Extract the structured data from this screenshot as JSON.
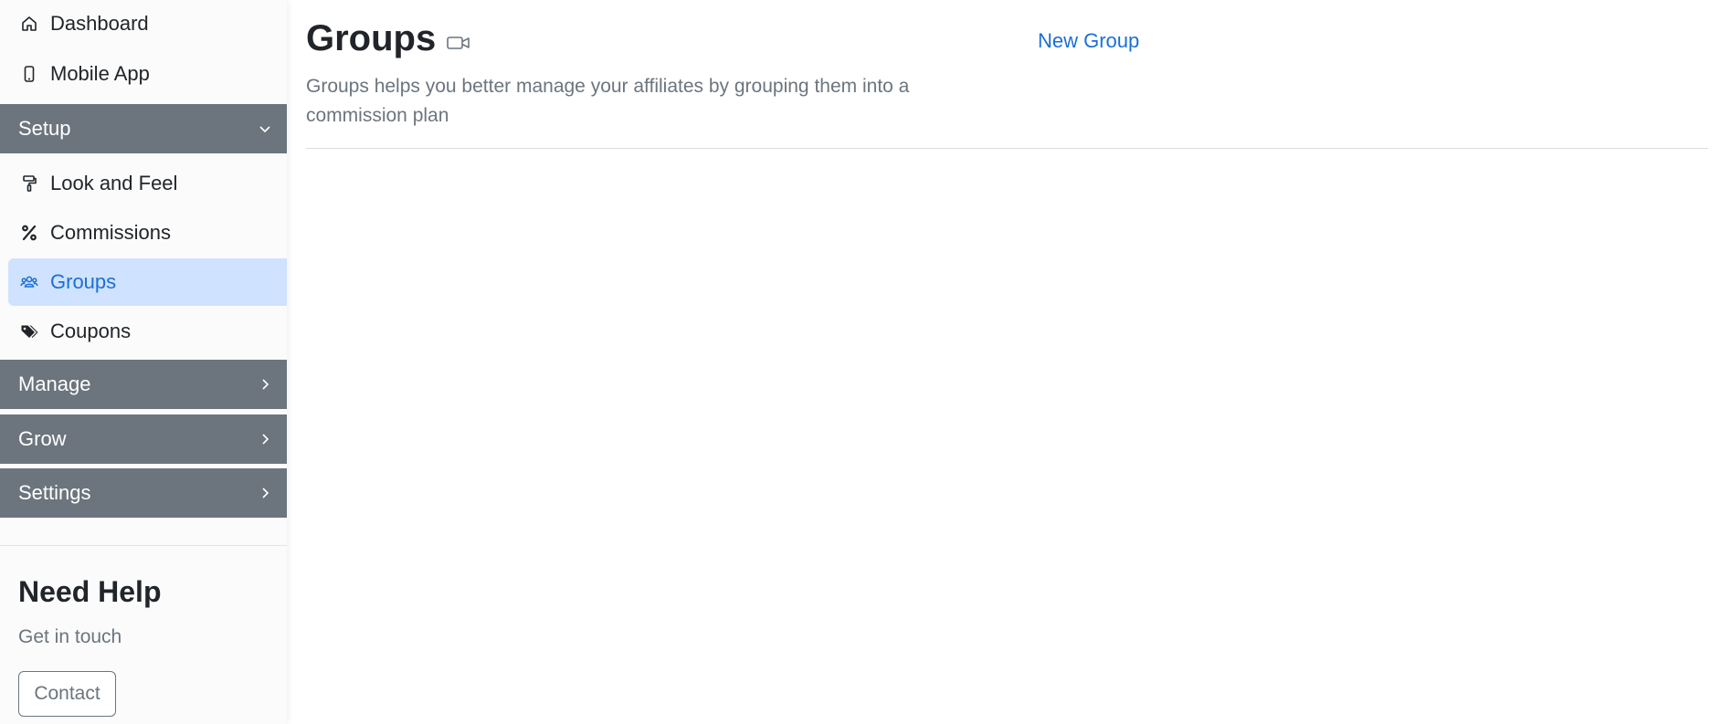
{
  "sidebar": {
    "top_items": [
      {
        "label": "Dashboard",
        "icon": "house-icon"
      },
      {
        "label": "Mobile App",
        "icon": "phone-icon"
      }
    ],
    "sections": {
      "setup": {
        "label": "Setup",
        "expanded": true,
        "items": [
          {
            "label": "Look and Feel",
            "icon": "paint-roller-icon"
          },
          {
            "label": "Commissions",
            "icon": "percent-icon"
          },
          {
            "label": "Groups",
            "icon": "users-icon",
            "active": true
          },
          {
            "label": "Coupons",
            "icon": "tags-icon"
          }
        ]
      },
      "manage": {
        "label": "Manage",
        "expanded": false
      },
      "grow": {
        "label": "Grow",
        "expanded": false
      },
      "settings": {
        "label": "Settings",
        "expanded": false
      }
    },
    "help": {
      "title": "Need Help",
      "subtitle": "Get in touch",
      "contact_label": "Contact"
    }
  },
  "main": {
    "title": "Groups",
    "description": "Groups helps you better manage your affiliates by grouping them into a commission plan",
    "new_group_label": "New Group"
  },
  "colors": {
    "accent": "#1a6fd8",
    "section_header_bg": "#6c757d",
    "active_item_bg": "#cfe2ff",
    "muted_text": "#6c757d"
  }
}
